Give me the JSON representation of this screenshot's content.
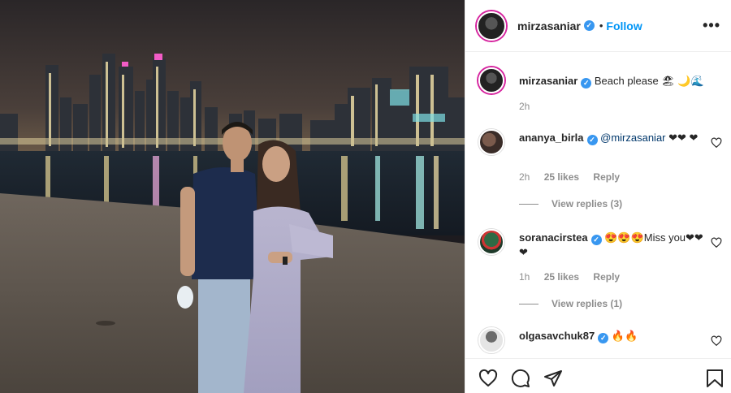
{
  "post": {
    "username": "mirzasaniar",
    "follow_label": "Follow",
    "separator": "•",
    "more_label": "•••",
    "verified_glyph": "✓"
  },
  "caption": {
    "username": "mirzasaniar",
    "text": "Beach please 🏖 🌙🌊",
    "time": "2h"
  },
  "comments": [
    {
      "username": "ananya_birla",
      "mention": "@mirzasaniar",
      "text": "❤❤ ❤",
      "time": "2h",
      "likes": "25 likes",
      "reply_label": "Reply",
      "view_replies": "View replies (3)"
    },
    {
      "username": "soranacirstea",
      "mention": "",
      "text": "😍😍😍Miss you❤❤ ❤",
      "time": "1h",
      "likes": "25 likes",
      "reply_label": "Reply",
      "view_replies": "View replies (1)"
    },
    {
      "username": "olgasavchuk87",
      "mention": "",
      "text": "🔥🔥",
      "time": "",
      "likes": "",
      "reply_label": "",
      "view_replies": ""
    }
  ],
  "icons": {
    "like": "heart-icon",
    "comment": "comment-icon",
    "share": "share-icon",
    "save": "bookmark-icon"
  },
  "colors": {
    "accent": "#0095f6",
    "verified": "#3897f0",
    "muted": "#8e8e8e"
  }
}
